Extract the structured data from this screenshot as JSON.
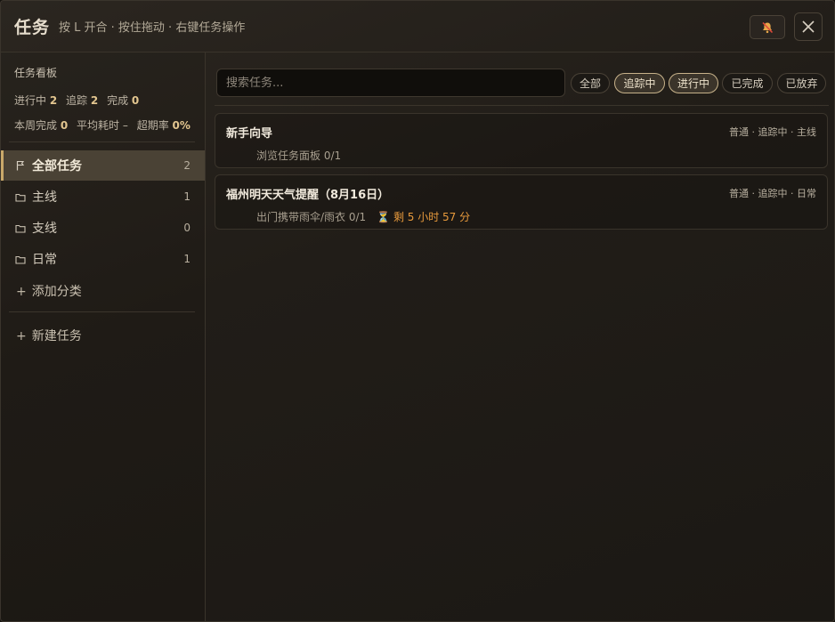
{
  "header": {
    "title": "任务",
    "hint": "按 L 开合 · 按住拖动 · 右键任务操作"
  },
  "sidebar": {
    "board_title": "任务看板",
    "stats1": [
      {
        "label": "进行中",
        "value": "2"
      },
      {
        "label": "追踪",
        "value": "2"
      },
      {
        "label": "完成",
        "value": "0"
      }
    ],
    "stats2": [
      {
        "label": "本周完成",
        "value": "0"
      },
      {
        "label": "平均耗时",
        "value": "–"
      },
      {
        "label": "超期率",
        "value": "0%"
      }
    ],
    "categories": [
      {
        "label": "全部任务",
        "count": "2",
        "icon": "flag-icon",
        "active": true
      },
      {
        "label": "主线",
        "count": "1",
        "icon": "folder-icon"
      },
      {
        "label": "支线",
        "count": "0",
        "icon": "folder-icon"
      },
      {
        "label": "日常",
        "count": "1",
        "icon": "folder-icon"
      }
    ],
    "add_category": "添加分类",
    "new_task": "新建任务"
  },
  "main": {
    "search_placeholder": "搜索任务...",
    "filters": [
      {
        "label": "全部",
        "active": false
      },
      {
        "label": "追踪中",
        "active": true
      },
      {
        "label": "进行中",
        "active": true
      },
      {
        "label": "已完成",
        "active": false
      },
      {
        "label": "已放弃",
        "active": false
      }
    ],
    "tasks": [
      {
        "title": "新手向导",
        "meta": "普通 · 追踪中 · 主线",
        "subtask": "浏览任务面板 0/1",
        "timer": ""
      },
      {
        "title": "福州明天天气提醒（8月16日）",
        "meta": "普通 · 追踪中 · 日常",
        "subtask": "出门携带雨伞/雨衣 0/1",
        "timer": "剩 5 小时 57 分"
      }
    ]
  },
  "colors": {
    "accent": "#c9a86a",
    "timer": "#e89a3c",
    "stat_value": "#e2c58f"
  }
}
